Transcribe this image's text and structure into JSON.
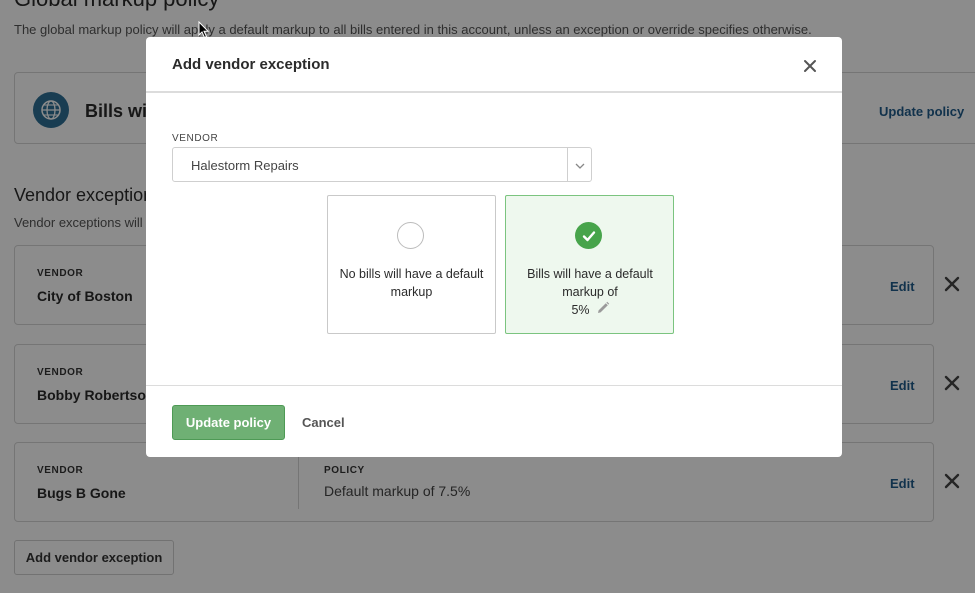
{
  "page": {
    "title": "Global markup policy",
    "description": "The global markup policy will apply a default markup to all bills entered in this account, unless an exception or override specifies otherwise."
  },
  "global_policy": {
    "title": "Bills will",
    "update_label": "Update policy"
  },
  "vendor_exceptions": {
    "title": "Vendor exception",
    "description": "Vendor exceptions will ov",
    "items": [
      {
        "label": "VENDOR",
        "name": "City of Boston",
        "policy_label": "",
        "policy_value": "",
        "edit_label": "Edit"
      },
      {
        "label": "VENDOR",
        "name": "Bobby Robertson",
        "policy_label": "",
        "policy_value": "",
        "edit_label": "Edit"
      },
      {
        "label": "VENDOR",
        "name": "Bugs B Gone",
        "policy_label": "POLICY",
        "policy_value": "Default markup of 7.5%",
        "edit_label": "Edit"
      }
    ],
    "add_label": "Add vendor exception"
  },
  "modal": {
    "title": "Add vendor exception",
    "vendor_label": "VENDOR",
    "vendor_value": "Halestorm Repairs",
    "options": [
      {
        "text": "No bills will have a default markup",
        "selected": false
      },
      {
        "text": "Bills will have a default markup of",
        "value": "5%",
        "selected": true
      }
    ],
    "primary_label": "Update policy",
    "cancel_label": "Cancel"
  },
  "colors": {
    "accent_green": "#6fb074",
    "check_green": "#47a44b",
    "link_blue": "#1f5b8a",
    "globe_blue": "#2e6f95"
  }
}
